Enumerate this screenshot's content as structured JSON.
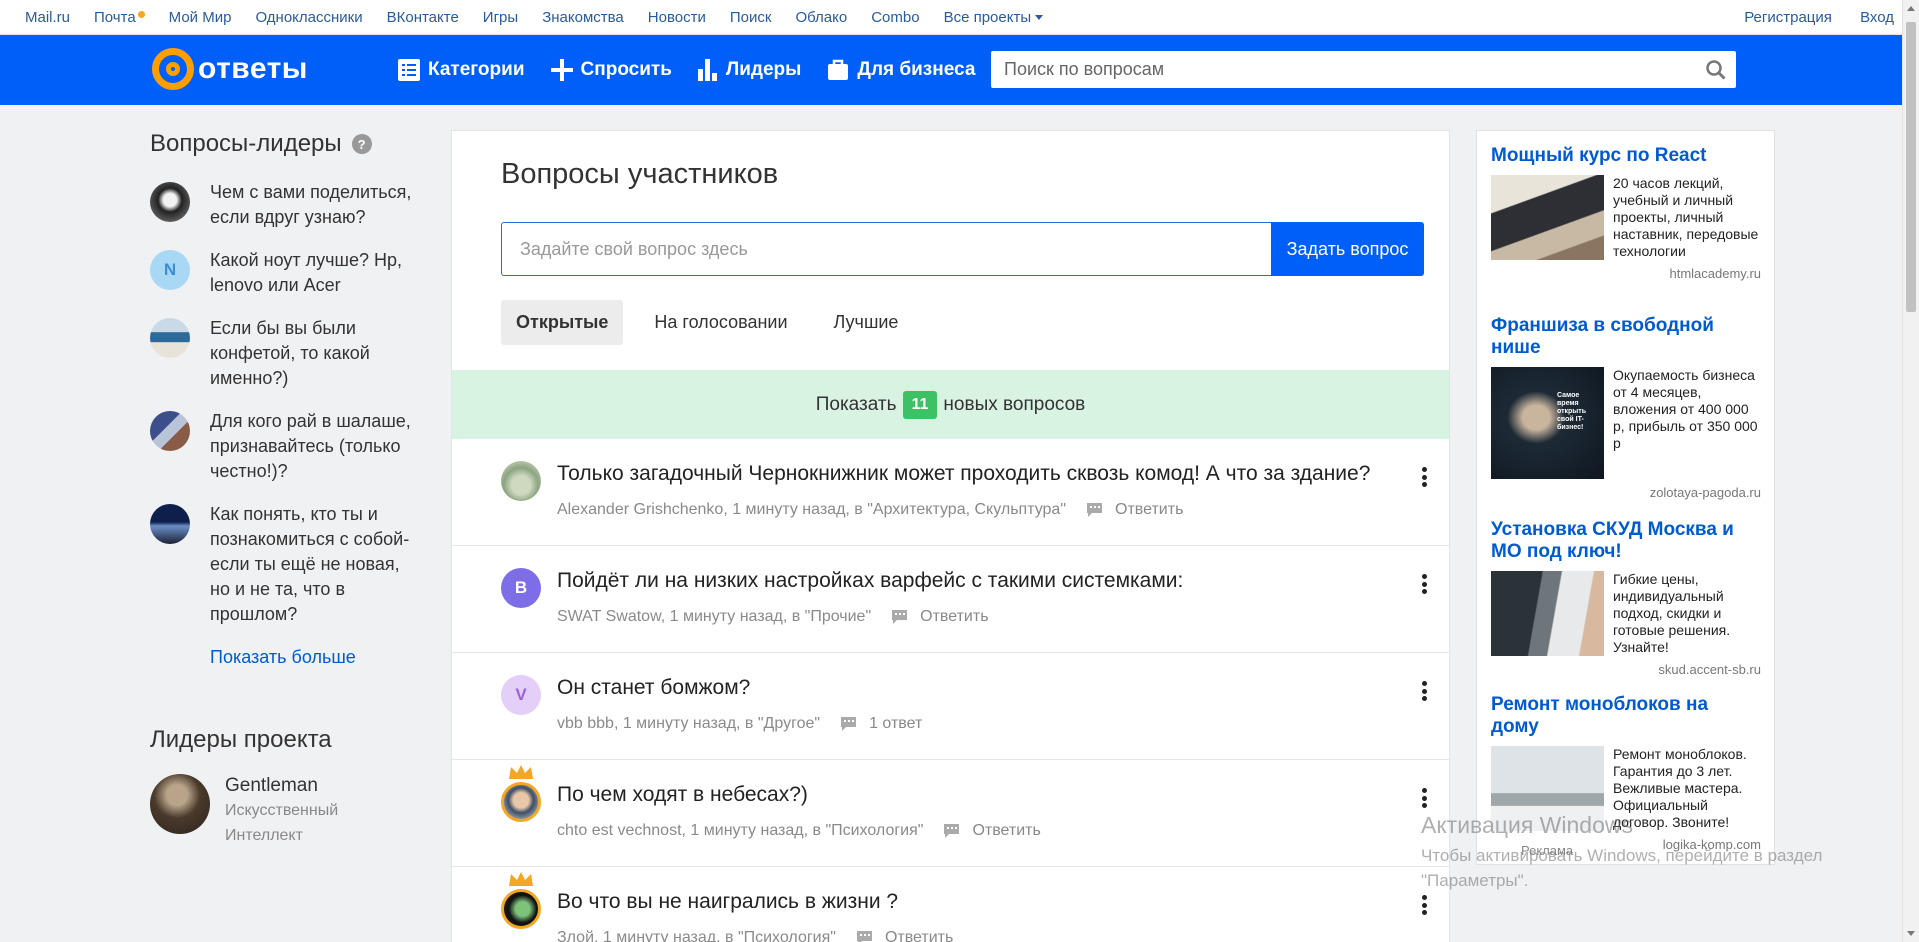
{
  "portal": {
    "links": [
      "Mail.ru",
      "Почта",
      "Мой Мир",
      "Одноклассники",
      "ВКонтакте",
      "Игры",
      "Знакомства",
      "Новости",
      "Поиск",
      "Облако",
      "Combo",
      "Все проекты"
    ],
    "register": "Регистрация",
    "login": "Вход"
  },
  "header": {
    "logo_text": "ответы",
    "nav": [
      "Категории",
      "Спросить",
      "Лидеры",
      "Для бизнеса"
    ],
    "search_placeholder": "Поиск по вопросам",
    "brand_color": "#005ff9",
    "logo_color": "#ff9e00"
  },
  "sidebar": {
    "leader_questions_title": "Вопросы-лидеры",
    "help_mark": "?",
    "questions": [
      "Чем с вами поделиться, если вдруг узнаю?",
      "Какой ноут лучше? Hp, lenovo или Acer",
      "Если бы вы были конфетой, то какой именно?)",
      "Для кого рай в шалаше, признавайтесь (только честно!)?",
      "Как понять, кто ты и познакомиться с собой- если ты ещё не новая, но и не та, что в прошлом?"
    ],
    "avatar_letter_2": "N",
    "show_more": "Показать больше",
    "leaders_title": "Лидеры проекта",
    "leader": {
      "name": "Gentleman",
      "rank": "Искусственный Интеллект"
    }
  },
  "main": {
    "title": "Вопросы участников",
    "ask_placeholder": "Задайте свой вопрос здесь",
    "ask_button": "Задать вопрос",
    "tabs": [
      "Открытые",
      "На голосовании",
      "Лучшие"
    ],
    "new_prefix": "Показать",
    "new_count": "11",
    "new_suffix": "новых вопросов",
    "questions": [
      {
        "title": "Только загадочный Чернокнижник может проходить сквозь комод! А что за здание?",
        "meta": "Alexander Grishchenko, 1 минуту назад, в \"Архитектура, Скульптура\"",
        "action": "Ответить",
        "avatar_letter": "",
        "avatar_color": "#9db89a"
      },
      {
        "title": "Пойдёт ли на низких настройках варфейс с такими системками:",
        "meta": "SWAT Swatow, 1 минуту назад, в \"Прочие\"",
        "action": "Ответить",
        "avatar_letter": "B",
        "avatar_color": "#7d6ee8"
      },
      {
        "title": "Он станет бомжом?",
        "meta": "vbb bbb, 1 минуту назад, в \"Другое\"",
        "action": "1 ответ",
        "avatar_letter": "V",
        "avatar_color": "#e3cff8"
      },
      {
        "title": "По чем ходят в небесах?)",
        "meta": "chto est vechnost, 1 минуту назад, в \"Психология\"",
        "action": "Ответить",
        "avatar_letter": "",
        "avatar_color": "#6a8fb5"
      },
      {
        "title": "Во что вы не наигрались в жизни ?",
        "meta": "Злой, 1 минуту назад, в \"Психология\"",
        "action": "Ответить",
        "avatar_letter": "",
        "avatar_color": "#2f7d3a"
      }
    ]
  },
  "ads": {
    "items": [
      {
        "title": "Мощный курс по React",
        "text": "20 часов лекций, учебный и личный проекты, личный наставник, передовые технологии",
        "domain": "htmlacademy.ru"
      },
      {
        "title": "Франшиза в свободной нише",
        "text": "Окупаемость бизнеса от 4 месяцев, вложения от 400 000 р, прибыль от 350 000 р",
        "domain": "zolotaya-pagoda.ru",
        "image_caption": "Самое время открыть свой IT-бизнес!"
      },
      {
        "title": "Установка СКУД Москва и МО под ключ!",
        "text": "Гибкие цены, индивидуальный подход, скидки и готовые решения. Узнайте!",
        "domain": "skud.accent-sb.ru"
      },
      {
        "title": "Ремонт моноблоков на дому",
        "text": "Ремонт моноблоков. Гарантия до 3 лет. Вежливые мастера. Официальный договор. Звоните!",
        "domain": "logika-komp.com"
      }
    ],
    "label": "Реклама"
  },
  "watermark": {
    "title": "Активация Windows",
    "text": "Чтобы активировать Windows, перейдите в раздел \"Параметры\"."
  }
}
